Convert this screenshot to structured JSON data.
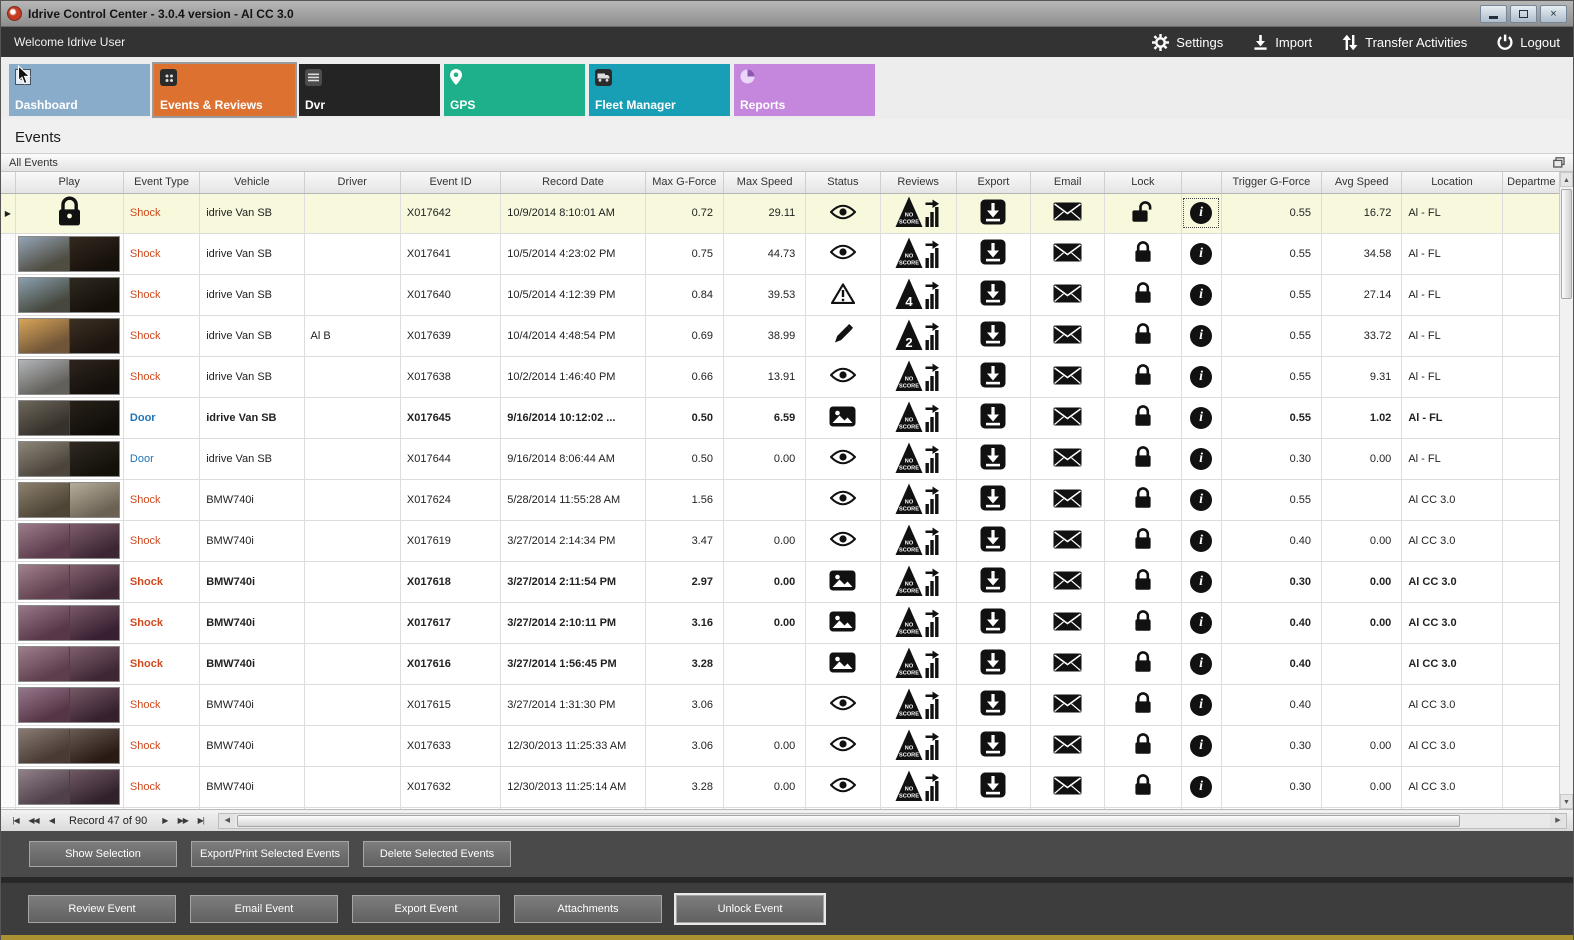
{
  "window": {
    "title": "Idrive Control Center - 3.0.4 version - Al CC 3.0"
  },
  "header": {
    "welcome": "Welcome Idrive User",
    "actions": [
      {
        "id": "settings",
        "label": "Settings",
        "icon": "gear-icon"
      },
      {
        "id": "import",
        "label": "Import",
        "icon": "import-icon"
      },
      {
        "id": "transfer-activities",
        "label": "Transfer Activities",
        "icon": "transfer-icon"
      },
      {
        "id": "logout",
        "label": "Logout",
        "icon": "power-icon"
      }
    ]
  },
  "nav_tiles": [
    {
      "id": "dashboard",
      "label": "Dashboard",
      "color": "#8aaccb",
      "icon": "checkmark-icon",
      "active": false
    },
    {
      "id": "events-reviews",
      "label": "Events & Reviews",
      "color": "#dd7230",
      "icon": "grid-icon",
      "active": true
    },
    {
      "id": "dvr",
      "label": "Dvr",
      "color": "#242424",
      "icon": "dvr-icon",
      "active": false
    },
    {
      "id": "gps",
      "label": "GPS",
      "color": "#1db08a",
      "icon": "map-pin-icon",
      "active": false
    },
    {
      "id": "fleet-manager",
      "label": "Fleet Manager",
      "color": "#189fb5",
      "icon": "vehicle-icon",
      "active": false
    },
    {
      "id": "reports",
      "label": "Reports",
      "color": "#c487dd",
      "icon": "pie-chart-icon",
      "active": false
    }
  ],
  "page": {
    "title": "Events",
    "group_label": "All Events"
  },
  "table": {
    "columns": [
      "Play",
      "Event Type",
      "Vehicle",
      "Driver",
      "Event ID",
      "Record Date",
      "Max G-Force",
      "Max Speed",
      "Status",
      "Reviews",
      "Export",
      "Email",
      "Lock",
      "",
      "Trigger G-Force",
      "Avg Speed",
      "Location",
      "Departme"
    ],
    "rows": [
      {
        "selected": true,
        "bold": false,
        "play": "lock",
        "thumb": null,
        "event_type": "Shock",
        "type_class": "shock",
        "vehicle": "idrive Van SB",
        "driver": "",
        "event_id": "X017642",
        "record_date": "10/9/2014 8:10:01 AM",
        "max_g": "0.72",
        "max_speed": "29.11",
        "status": "viewed",
        "score": "NO SCORE",
        "lock": "unlocked",
        "trigger_g": "0.55",
        "avg_speed": "16.72",
        "location": "Al - FL",
        "department": ""
      },
      {
        "selected": false,
        "bold": false,
        "play": "thumb",
        "thumb": [
          "#94a5b5",
          "#4f4c42",
          "#33291f",
          "#16100b"
        ],
        "event_type": "Shock",
        "type_class": "shock",
        "vehicle": "idrive Van SB",
        "driver": "",
        "event_id": "X017641",
        "record_date": "10/5/2014 4:23:02 PM",
        "max_g": "0.75",
        "max_speed": "44.73",
        "status": "viewed",
        "score": "NO SCORE",
        "lock": "locked",
        "trigger_g": "0.55",
        "avg_speed": "34.58",
        "location": "Al - FL",
        "department": ""
      },
      {
        "selected": false,
        "bold": false,
        "play": "thumb",
        "thumb": [
          "#8aa0ae",
          "#46483e",
          "#2e2a22",
          "#141008"
        ],
        "event_type": "Shock",
        "type_class": "shock",
        "vehicle": "idrive Van SB",
        "driver": "",
        "event_id": "X017640",
        "record_date": "10/5/2014 4:12:39 PM",
        "max_g": "0.84",
        "max_speed": "39.53",
        "status": "warning",
        "score": "4",
        "lock": "locked",
        "trigger_g": "0.55",
        "avg_speed": "27.14",
        "location": "Al - FL",
        "department": ""
      },
      {
        "selected": false,
        "bold": false,
        "play": "thumb",
        "thumb": [
          "#d8a558",
          "#715538",
          "#3c3023",
          "#1a130e"
        ],
        "event_type": "Shock",
        "type_class": "shock",
        "vehicle": "idrive Van SB",
        "driver": "Al B",
        "event_id": "X017639",
        "record_date": "10/4/2014 4:48:54 PM",
        "max_g": "0.69",
        "max_speed": "38.99",
        "status": "edited",
        "score": "2",
        "lock": "locked",
        "trigger_g": "0.55",
        "avg_speed": "33.72",
        "location": "Al - FL",
        "department": ""
      },
      {
        "selected": false,
        "bold": false,
        "play": "thumb",
        "thumb": [
          "#b3b6ba",
          "#62605a",
          "#2d241d",
          "#140f0a"
        ],
        "event_type": "Shock",
        "type_class": "shock",
        "vehicle": "idrive Van SB",
        "driver": "",
        "event_id": "X017638",
        "record_date": "10/2/2014 1:46:40 PM",
        "max_g": "0.66",
        "max_speed": "13.91",
        "status": "viewed",
        "score": "NO SCORE",
        "lock": "locked",
        "trigger_g": "0.55",
        "avg_speed": "9.31",
        "location": "Al - FL",
        "department": ""
      },
      {
        "selected": false,
        "bold": true,
        "play": "thumb",
        "thumb": [
          "#6d675c",
          "#36312a",
          "#282119",
          "#100d09"
        ],
        "event_type": "Door",
        "type_class": "door",
        "vehicle": "idrive Van SB",
        "driver": "",
        "event_id": "X017645",
        "record_date": "9/16/2014 10:12:02 ...",
        "max_g": "0.50",
        "max_speed": "6.59",
        "status": "snapshot",
        "score": "NO SCORE",
        "lock": "locked",
        "trigger_g": "0.55",
        "avg_speed": "1.02",
        "location": "Al - FL",
        "department": ""
      },
      {
        "selected": false,
        "bold": false,
        "play": "thumb",
        "thumb": [
          "#8d8679",
          "#4b453c",
          "#302a23",
          "#13100a"
        ],
        "event_type": "Door",
        "type_class": "door",
        "vehicle": "idrive Van SB",
        "driver": "",
        "event_id": "X017644",
        "record_date": "9/16/2014 8:06:44 AM",
        "max_g": "0.50",
        "max_speed": "0.00",
        "status": "viewed",
        "score": "NO SCORE",
        "lock": "locked",
        "trigger_g": "0.30",
        "avg_speed": "0.00",
        "location": "Al - FL",
        "department": ""
      },
      {
        "selected": false,
        "bold": false,
        "play": "thumb",
        "thumb": [
          "#8d816d",
          "#4e4537",
          "#b7ad9c",
          "#6c6253"
        ],
        "event_type": "Shock",
        "type_class": "shock",
        "vehicle": "BMW740i",
        "driver": "",
        "event_id": "X017624",
        "record_date": "5/28/2014 11:55:28 AM",
        "max_g": "1.56",
        "max_speed": "",
        "status": "viewed",
        "score": "NO SCORE",
        "lock": "locked",
        "trigger_g": "0.55",
        "avg_speed": "",
        "location": "Al CC 3.0",
        "department": ""
      },
      {
        "selected": false,
        "bold": false,
        "play": "thumb",
        "thumb": [
          "#9c7c8a",
          "#5c3c4c",
          "#7d5c6a",
          "#3d2633"
        ],
        "event_type": "Shock",
        "type_class": "shock",
        "vehicle": "BMW740i",
        "driver": "",
        "event_id": "X017619",
        "record_date": "3/27/2014 2:14:34 PM",
        "max_g": "3.47",
        "max_speed": "0.00",
        "status": "viewed",
        "score": "NO SCORE",
        "lock": "locked",
        "trigger_g": "0.40",
        "avg_speed": "0.00",
        "location": "Al CC 3.0",
        "department": ""
      },
      {
        "selected": false,
        "bold": true,
        "play": "thumb",
        "thumb": [
          "#a2808e",
          "#60404e",
          "#82606e",
          "#402836"
        ],
        "event_type": "Shock",
        "type_class": "shock",
        "vehicle": "BMW740i",
        "driver": "",
        "event_id": "X017618",
        "record_date": "3/27/2014 2:11:54 PM",
        "max_g": "2.97",
        "max_speed": "0.00",
        "status": "snapshot",
        "score": "NO SCORE",
        "lock": "locked",
        "trigger_g": "0.30",
        "avg_speed": "0.00",
        "location": "Al CC 3.0",
        "department": ""
      },
      {
        "selected": false,
        "bold": true,
        "play": "thumb",
        "thumb": [
          "#987888",
          "#583848",
          "#785868",
          "#382030"
        ],
        "event_type": "Shock",
        "type_class": "shock",
        "vehicle": "BMW740i",
        "driver": "",
        "event_id": "X017617",
        "record_date": "3/27/2014 2:10:11 PM",
        "max_g": "3.16",
        "max_speed": "0.00",
        "status": "snapshot",
        "score": "NO SCORE",
        "lock": "locked",
        "trigger_g": "0.40",
        "avg_speed": "0.00",
        "location": "Al CC 3.0",
        "department": ""
      },
      {
        "selected": false,
        "bold": true,
        "play": "thumb",
        "thumb": [
          "#9e7e8c",
          "#5e3e4c",
          "#7e5e6c",
          "#3e2634"
        ],
        "event_type": "Shock",
        "type_class": "shock",
        "vehicle": "BMW740i",
        "driver": "",
        "event_id": "X017616",
        "record_date": "3/27/2014 1:56:45 PM",
        "max_g": "3.28",
        "max_speed": "",
        "status": "snapshot",
        "score": "NO SCORE",
        "lock": "locked",
        "trigger_g": "0.40",
        "avg_speed": "",
        "location": "Al CC 3.0",
        "department": ""
      },
      {
        "selected": false,
        "bold": false,
        "play": "thumb",
        "thumb": [
          "#96768a",
          "#563646",
          "#765866",
          "#36202e"
        ],
        "event_type": "Shock",
        "type_class": "shock",
        "vehicle": "BMW740i",
        "driver": "",
        "event_id": "X017615",
        "record_date": "3/27/2014 1:31:30 PM",
        "max_g": "3.06",
        "max_speed": "",
        "status": "viewed",
        "score": "NO SCORE",
        "lock": "locked",
        "trigger_g": "0.40",
        "avg_speed": "",
        "location": "Al CC 3.0",
        "department": ""
      },
      {
        "selected": false,
        "bold": false,
        "play": "thumb",
        "thumb": [
          "#8a7a74",
          "#4a3a34",
          "#6a5a54",
          "#2a1a14"
        ],
        "event_type": "Shock",
        "type_class": "shock",
        "vehicle": "BMW740i",
        "driver": "",
        "event_id": "X017633",
        "record_date": "12/30/2013 11:25:33 AM",
        "max_g": "3.06",
        "max_speed": "0.00",
        "status": "viewed",
        "score": "NO SCORE",
        "lock": "locked",
        "trigger_g": "0.30",
        "avg_speed": "0.00",
        "location": "Al CC 3.0",
        "department": ""
      },
      {
        "selected": false,
        "bold": false,
        "play": "thumb",
        "thumb": [
          "#90808a",
          "#50404a",
          "#705a64",
          "#30202a"
        ],
        "event_type": "Shock",
        "type_class": "shock",
        "vehicle": "BMW740i",
        "driver": "",
        "event_id": "X017632",
        "record_date": "12/30/2013 11:25:14 AM",
        "max_g": "3.28",
        "max_speed": "0.00",
        "status": "viewed",
        "score": "NO SCORE",
        "lock": "locked",
        "trigger_g": "0.30",
        "avg_speed": "0.00",
        "location": "Al CC 3.0",
        "department": ""
      },
      {
        "selected": false,
        "bold": false,
        "partial": true,
        "play": "thumb",
        "thumb": [
          "#8c7c86",
          "#4c3c46",
          "#6c565e",
          "#2c1c26"
        ],
        "event_type": "",
        "type_class": "",
        "vehicle": "",
        "driver": "",
        "event_id": "",
        "record_date": "",
        "max_g": "",
        "max_speed": "",
        "status": "",
        "score": "",
        "lock": "",
        "trigger_g": "",
        "avg_speed": "",
        "location": "",
        "department": ""
      }
    ]
  },
  "record_nav": {
    "text": "Record 47 of 90"
  },
  "selection_panel": {
    "buttons": [
      "Show Selection",
      "Export/Print Selected Events",
      "Delete Selected  Events"
    ]
  },
  "event_panel": {
    "buttons": [
      "Review Event",
      "Email Event",
      "Export Event",
      "Attachments",
      "Unlock Event"
    ],
    "focused": "Unlock Event"
  },
  "colors": {
    "shock": "#cf4a1e",
    "door": "#1f74b8",
    "accent_strip": "#ab9132",
    "selected_row": "#f8f8dd"
  }
}
